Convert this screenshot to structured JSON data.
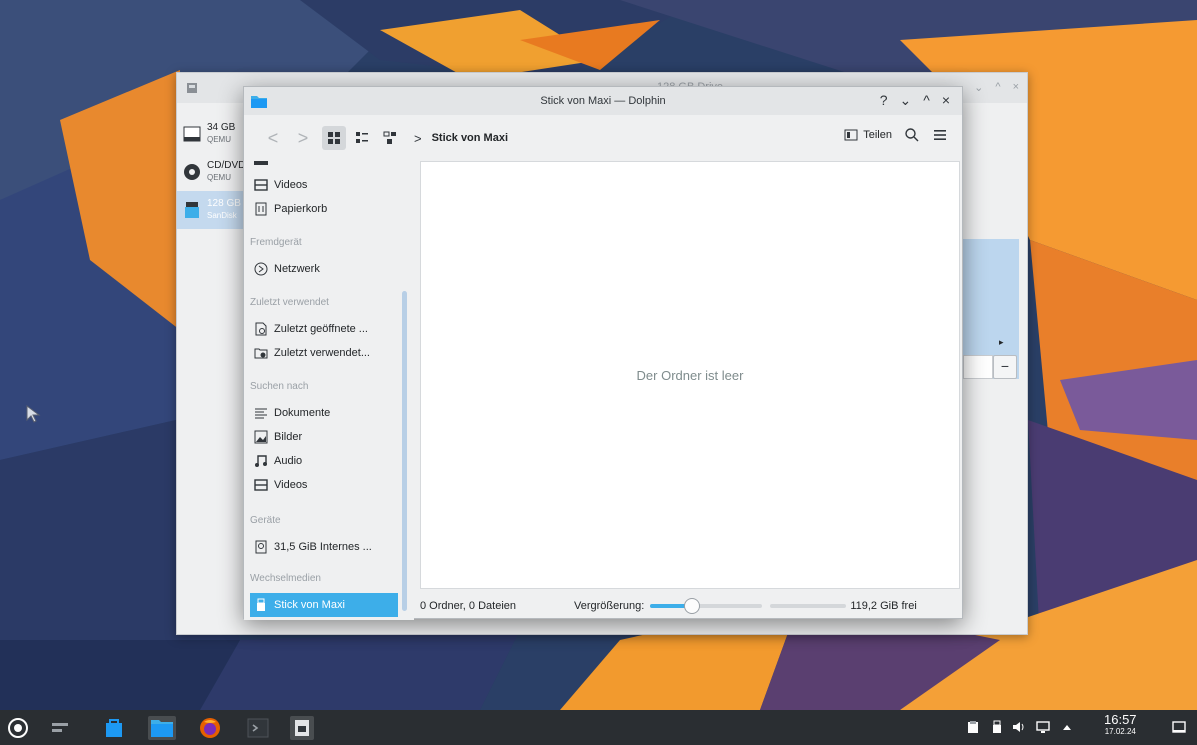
{
  "background_window": {
    "title": "128 GB Drive",
    "devices": [
      {
        "name": "34 GB",
        "sub": "QEMU"
      },
      {
        "name": "CD/DVD",
        "sub": "QEMU"
      },
      {
        "name": "128 GB",
        "sub": "SanDisk"
      }
    ],
    "controls": {
      "minimize": "⌄",
      "maximize": "^",
      "close": "×"
    },
    "minus_label": "−",
    "arrow_label": "▸"
  },
  "dolphin": {
    "title": "Stick von Maxi — Dolphin",
    "title_controls": {
      "help": "?",
      "minimize": "⌄",
      "maximize": "^",
      "close": "×"
    },
    "toolbar": {
      "back": "<",
      "forward": ">",
      "breadcrumb_sep": ">",
      "breadcrumb": "Stick von Maxi",
      "share_label": "Teilen"
    },
    "sidebar": {
      "items_top": [
        {
          "label": "Videos",
          "icon": "video-icon"
        },
        {
          "label": "Papierkorb",
          "icon": "trash-icon"
        }
      ],
      "section_remote": "Fremdgerät",
      "network": "Netzwerk",
      "section_recent": "Zuletzt verwendet",
      "recent_files": "Zuletzt geöffnete ...",
      "recent_locations": "Zuletzt verwendet...",
      "section_search": "Suchen nach",
      "search_items": [
        {
          "label": "Dokumente",
          "icon": "documents-icon"
        },
        {
          "label": "Bilder",
          "icon": "image-icon"
        },
        {
          "label": "Audio",
          "icon": "audio-icon"
        },
        {
          "label": "Videos",
          "icon": "video-icon"
        }
      ],
      "section_devices": "Geräte",
      "internal_drive": "31,5 GiB Internes ...",
      "section_removable": "Wechselmedien",
      "usb_stick": "Stick von Maxi"
    },
    "main": {
      "empty_message": "Der Ordner ist leer"
    },
    "status": {
      "counts": "0 Ordner, 0 Dateien",
      "zoom_label": "Vergrößerung:",
      "zoom_level": 0.35,
      "free_space": "119,2 GiB frei"
    }
  },
  "taskbar": {
    "time": "16:57",
    "date": "17.02.24"
  },
  "colors": {
    "accent": "#3daee9",
    "taskbar": "#2a2e32",
    "window_bg": "#eff0f1"
  }
}
